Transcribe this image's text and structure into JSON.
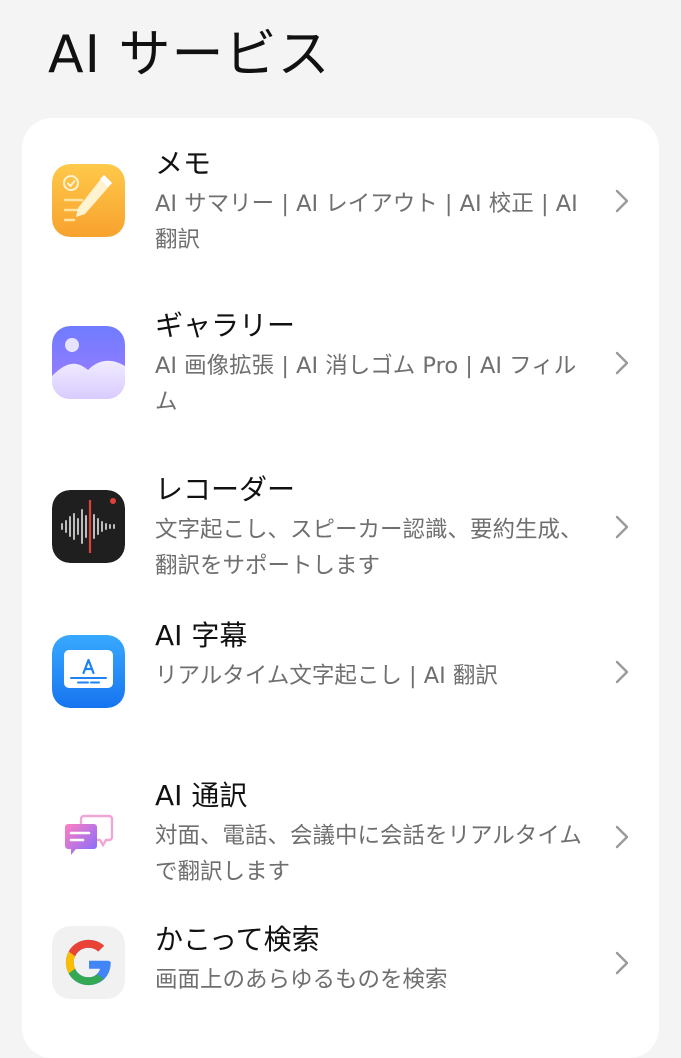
{
  "page": {
    "title": "AI サービス"
  },
  "services": [
    {
      "title": "メモ",
      "description": "AI サマリー | AI レイアウト | AI 校正 | AI 翻訳",
      "icon": "notes-pencil-icon"
    },
    {
      "title": "ギャラリー",
      "description": "AI 画像拡張 | AI 消しゴム Pro | AI フィルム",
      "icon": "gallery-landscape-icon"
    },
    {
      "title": "レコーダー",
      "description": "文字起こし、スピーカー認識、要約生成、翻訳をサポートします",
      "icon": "recorder-waveform-icon"
    },
    {
      "title": "AI 字幕",
      "description": "リアルタイム文字起こし | AI 翻訳",
      "icon": "subtitle-a-icon"
    },
    {
      "title": "AI 通訳",
      "description": "対面、電話、会議中に会話をリアルタイムで翻訳します",
      "icon": "chat-bubbles-icon"
    },
    {
      "title": "かこって検索",
      "description": "画面上のあらゆるものを検索",
      "icon": "google-g-icon"
    }
  ],
  "colors": {
    "background": "#f4f4f4",
    "card": "#ffffff",
    "title_text": "#111111",
    "description_text": "#6f6f6f",
    "chevron": "#9a9a9a"
  }
}
